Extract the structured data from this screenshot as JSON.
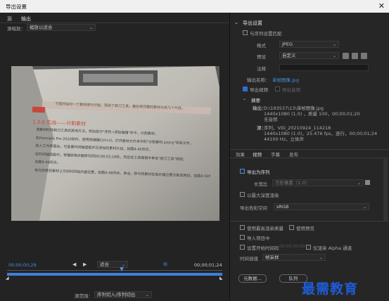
{
  "window": {
    "title": "导出设置",
    "close": "✕"
  },
  "left": {
    "tabs": [
      "源",
      "输出"
    ],
    "source_scaling_label": "源缩放：",
    "source_scaling_value": "缩放以适合",
    "timecode_start": "00;00;00;29",
    "timecode_end": "00;00;01;24",
    "fit_value": "适合",
    "source_range_label": "源范围：",
    "source_range_value": "序列切入/序列切出",
    "page_text": {
      "heading": "1.3.6  实战——分割素材",
      "red_box_text": "下面开始对一个素材进行分割，用到了剃刀工具，最后将完整的素材分成几个片段。",
      "body": [
        "请素材时除剃刀工具的其他方法，例如执行\"序列→添加编辑\"命令，分割素材。",
        "在Premiere Pro 2020软件，使用快捷键Ctrl+O，打开素材文件夹中的\"分割素材.prproj\"项目文件。",
        "进入工作界面后，可查看时间轴面板中已添加的素材片段，如图4-45所示。",
        "在时间轴面板中，将播放指示器移动到00;00;02;18处，然后在工具面板中单击\"剃刀工具\"按钮。",
        "如图4-46所示。",
        "将光标移到素材上方的时间指示器位置，如图4-48所示。单击，即可将素材在指示器位置分割成两段，如图4-50所示。"
      ]
    }
  },
  "right": {
    "export_settings_title": "导出设置",
    "match_sequence": "与序列设置匹配",
    "format_label": "格式",
    "format_value": "JPEG",
    "preset_label": "预设",
    "preset_value": "自定义",
    "comment_label": "注释",
    "output_name_label": "输出名称：",
    "output_name_value": "单帧图像.jpg",
    "export_video": "导出视频",
    "export_audio": "导出音频",
    "summary_title": "摘要",
    "output_label": "输出：",
    "output_path": "D:\\193537\\13\\单帧图像.jpg",
    "output_line2": "1440x1080 (1.0) ，质量 100，00;00;01;20",
    "output_line3": "无音频",
    "source_label": "源：",
    "source_seq": "序列，VID_20210924_114218",
    "source_line2": "1440x1080 (1.0)，25.476 fps，逐行，00;00;01;24",
    "source_line3": "44100 Hz，立体声",
    "subtabs": [
      "效果",
      "视频",
      "字幕",
      "发布"
    ],
    "export_as_sequence": "导出为序列",
    "aspect_label": "长宽比",
    "aspect_value": "方形像素（1.0）",
    "render_max_depth": "以最大深度渲染",
    "export_color_space_label": "导出色彩空间",
    "export_color_space_value": "sRGB",
    "use_max_render_quality": "使用最高渲染质量",
    "use_previews": "使用预览",
    "import_into_project": "导入项目中",
    "set_start_timecode": "设置开始时间码",
    "timecode_value": "00;00;00;00",
    "render_alpha": "仅渲染 Alpha 通道",
    "time_interpolation_label": "时间插值",
    "time_interpolation_value": "帧采样",
    "metadata_button": "元数据...",
    "queue_button": "队列",
    "watermark": "最需教育"
  }
}
